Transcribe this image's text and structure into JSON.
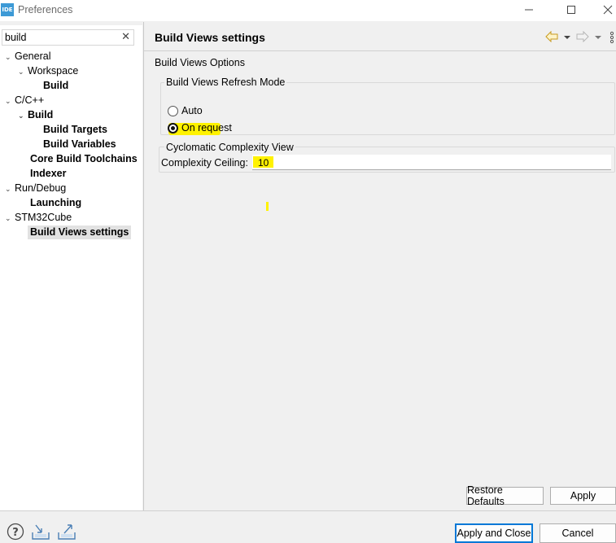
{
  "window": {
    "app_icon_label": "IDE",
    "title": "Preferences",
    "minimize_icon": "minimize-icon",
    "maximize_icon": "maximize-icon",
    "close_icon": "close-icon"
  },
  "filter": {
    "value": "build",
    "clear_icon": "close-icon"
  },
  "tree": [
    {
      "label": "General",
      "expanded": true,
      "bold": false
    },
    {
      "label": "Workspace",
      "expanded": true,
      "bold": false
    },
    {
      "label": "Build",
      "bold": true
    },
    {
      "label": "C/C++",
      "expanded": true,
      "bold": false
    },
    {
      "label": "Build",
      "expanded": true,
      "bold": true
    },
    {
      "label": "Build Targets",
      "bold": true
    },
    {
      "label": "Build Variables",
      "bold": true
    },
    {
      "label": "Core Build Toolchains",
      "bold": true
    },
    {
      "label": "Indexer",
      "bold": true
    },
    {
      "label": "Run/Debug",
      "expanded": true,
      "bold": false
    },
    {
      "label": "Launching",
      "bold": true
    },
    {
      "label": "STM32Cube",
      "expanded": true,
      "bold": false
    },
    {
      "label": "Build Views settings",
      "bold": true,
      "selected": true
    }
  ],
  "page": {
    "title": "Build Views settings",
    "options_label": "Build Views Options",
    "refresh_group": {
      "legend": "Build Views Refresh Mode",
      "options": [
        {
          "label": "Auto",
          "selected": false
        },
        {
          "label": "On request",
          "selected": true
        }
      ]
    },
    "complexity_group": {
      "legend": "Cyclomatic Complexity View",
      "field_label": "Complexity Ceiling:",
      "field_value": "10"
    }
  },
  "buttons": {
    "restore_defaults": "Restore Defaults",
    "apply": "Apply",
    "apply_and_close": "Apply and Close",
    "cancel": "Cancel"
  },
  "colors": {
    "highlight": "#fff200",
    "app_icon": "#3d9ad6",
    "focus": "#0078d7"
  }
}
